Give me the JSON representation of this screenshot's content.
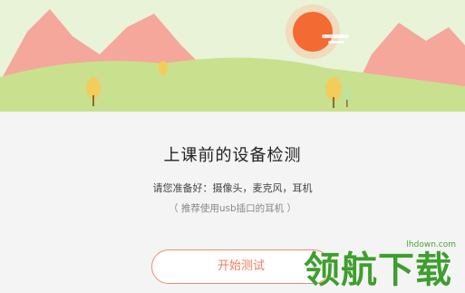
{
  "banner": {
    "colors": {
      "sky": "#e9f3d8",
      "sun": "#f46a33",
      "hill_back": "#f4a79a",
      "hill_front": "#c9e08e"
    }
  },
  "main": {
    "title": "上课前的设备检测",
    "subtitle": "请您准备好：摄像头，麦克风，耳机",
    "hint": "（ 推荐使用usb插口的耳机 ）",
    "start_button": "开始测试"
  },
  "watermark": {
    "site": "lhdown.com",
    "brand": "领航下载"
  }
}
